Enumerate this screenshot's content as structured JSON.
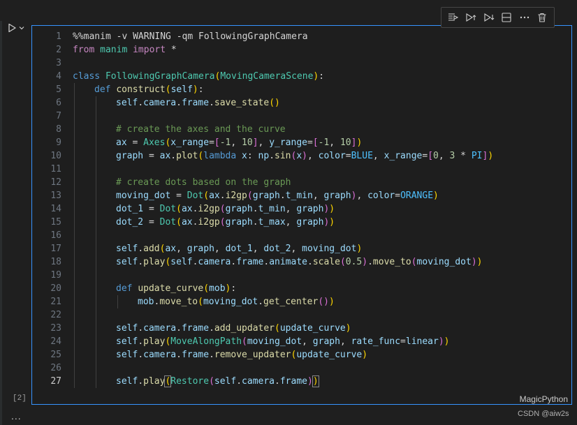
{
  "cell": {
    "execution_count": "[2]",
    "language": "MagicPython",
    "active_line": 27,
    "toolbar": [
      {
        "name": "execute-above-icon",
        "icon": "run-above"
      },
      {
        "name": "execute-below-icon",
        "icon": "run-below"
      },
      {
        "name": "execute-cell-below-icon",
        "icon": "run-cell-below"
      },
      {
        "name": "split-cell-icon",
        "icon": "split"
      },
      {
        "name": "more-actions-icon",
        "icon": "ellipsis"
      },
      {
        "name": "delete-cell-icon",
        "icon": "trash"
      }
    ],
    "lines": [
      {
        "n": "1",
        "indent": 0,
        "tokens": [
          [
            "pl",
            "%%manim -v WARNING -qm FollowingGraphCamera"
          ]
        ]
      },
      {
        "n": "2",
        "indent": 0,
        "tokens": [
          [
            "kw2",
            "from"
          ],
          [
            "pl",
            " "
          ],
          [
            "cls",
            "manim"
          ],
          [
            "pl",
            " "
          ],
          [
            "kw2",
            "import"
          ],
          [
            "pl",
            " *"
          ]
        ]
      },
      {
        "n": "3",
        "indent": 0,
        "tokens": []
      },
      {
        "n": "4",
        "indent": 0,
        "tokens": [
          [
            "kw",
            "class"
          ],
          [
            "pl",
            " "
          ],
          [
            "cls",
            "FollowingGraphCamera"
          ],
          [
            "br1",
            "("
          ],
          [
            "cls",
            "MovingCameraScene"
          ],
          [
            "br1",
            ")"
          ],
          [
            "pl",
            ":"
          ]
        ]
      },
      {
        "n": "5",
        "indent": 1,
        "tokens": [
          [
            "kw",
            "def"
          ],
          [
            "pl",
            " "
          ],
          [
            "fn",
            "construct"
          ],
          [
            "br1",
            "("
          ],
          [
            "self",
            "self"
          ],
          [
            "br1",
            ")"
          ],
          [
            "pl",
            ":"
          ]
        ]
      },
      {
        "n": "6",
        "indent": 2,
        "tokens": [
          [
            "self",
            "self"
          ],
          [
            "pl",
            "."
          ],
          [
            "var",
            "camera"
          ],
          [
            "pl",
            "."
          ],
          [
            "var",
            "frame"
          ],
          [
            "pl",
            "."
          ],
          [
            "fn",
            "save_state"
          ],
          [
            "br1",
            "()"
          ]
        ]
      },
      {
        "n": "7",
        "indent": 2,
        "tokens": []
      },
      {
        "n": "8",
        "indent": 2,
        "tokens": [
          [
            "cm",
            "# create the axes and the curve"
          ]
        ]
      },
      {
        "n": "9",
        "indent": 2,
        "tokens": [
          [
            "var",
            "ax"
          ],
          [
            "pl",
            " = "
          ],
          [
            "cls",
            "Axes"
          ],
          [
            "br1",
            "("
          ],
          [
            "var",
            "x_range"
          ],
          [
            "pl",
            "="
          ],
          [
            "br2",
            "["
          ],
          [
            "num",
            "-1"
          ],
          [
            "pl",
            ", "
          ],
          [
            "num",
            "10"
          ],
          [
            "br2",
            "]"
          ],
          [
            "pl",
            ", "
          ],
          [
            "var",
            "y_range"
          ],
          [
            "pl",
            "="
          ],
          [
            "br2",
            "["
          ],
          [
            "num",
            "-1"
          ],
          [
            "pl",
            ", "
          ],
          [
            "num",
            "10"
          ],
          [
            "br2",
            "]"
          ],
          [
            "br1",
            ")"
          ]
        ]
      },
      {
        "n": "10",
        "indent": 2,
        "tokens": [
          [
            "var",
            "graph"
          ],
          [
            "pl",
            " = "
          ],
          [
            "var",
            "ax"
          ],
          [
            "pl",
            "."
          ],
          [
            "fn",
            "plot"
          ],
          [
            "br1",
            "("
          ],
          [
            "kw",
            "lambda"
          ],
          [
            "pl",
            " "
          ],
          [
            "var",
            "x"
          ],
          [
            "pl",
            ": "
          ],
          [
            "var",
            "np"
          ],
          [
            "pl",
            "."
          ],
          [
            "fn",
            "sin"
          ],
          [
            "br2",
            "("
          ],
          [
            "var",
            "x"
          ],
          [
            "br2",
            ")"
          ],
          [
            "pl",
            ", "
          ],
          [
            "var",
            "color"
          ],
          [
            "pl",
            "="
          ],
          [
            "cst",
            "BLUE"
          ],
          [
            "pl",
            ", "
          ],
          [
            "var",
            "x_range"
          ],
          [
            "pl",
            "="
          ],
          [
            "br2",
            "["
          ],
          [
            "num",
            "0"
          ],
          [
            "pl",
            ", "
          ],
          [
            "num",
            "3"
          ],
          [
            "pl",
            " * "
          ],
          [
            "cst",
            "PI"
          ],
          [
            "br2",
            "]"
          ],
          [
            "br1",
            ")"
          ]
        ]
      },
      {
        "n": "11",
        "indent": 2,
        "tokens": []
      },
      {
        "n": "12",
        "indent": 2,
        "tokens": [
          [
            "cm",
            "# create dots based on the graph"
          ]
        ]
      },
      {
        "n": "13",
        "indent": 2,
        "tokens": [
          [
            "var",
            "moving_dot"
          ],
          [
            "pl",
            " = "
          ],
          [
            "cls",
            "Dot"
          ],
          [
            "br1",
            "("
          ],
          [
            "var",
            "ax"
          ],
          [
            "pl",
            "."
          ],
          [
            "fn",
            "i2gp"
          ],
          [
            "br2",
            "("
          ],
          [
            "var",
            "graph"
          ],
          [
            "pl",
            "."
          ],
          [
            "var",
            "t_min"
          ],
          [
            "pl",
            ", "
          ],
          [
            "var",
            "graph"
          ],
          [
            "br2",
            ")"
          ],
          [
            "pl",
            ", "
          ],
          [
            "var",
            "color"
          ],
          [
            "pl",
            "="
          ],
          [
            "cst",
            "ORANGE"
          ],
          [
            "br1",
            ")"
          ]
        ]
      },
      {
        "n": "14",
        "indent": 2,
        "tokens": [
          [
            "var",
            "dot_1"
          ],
          [
            "pl",
            " = "
          ],
          [
            "cls",
            "Dot"
          ],
          [
            "br1",
            "("
          ],
          [
            "var",
            "ax"
          ],
          [
            "pl",
            "."
          ],
          [
            "fn",
            "i2gp"
          ],
          [
            "br2",
            "("
          ],
          [
            "var",
            "graph"
          ],
          [
            "pl",
            "."
          ],
          [
            "var",
            "t_min"
          ],
          [
            "pl",
            ", "
          ],
          [
            "var",
            "graph"
          ],
          [
            "br2",
            ")"
          ],
          [
            "br1",
            ")"
          ]
        ]
      },
      {
        "n": "15",
        "indent": 2,
        "tokens": [
          [
            "var",
            "dot_2"
          ],
          [
            "pl",
            " = "
          ],
          [
            "cls",
            "Dot"
          ],
          [
            "br1",
            "("
          ],
          [
            "var",
            "ax"
          ],
          [
            "pl",
            "."
          ],
          [
            "fn",
            "i2gp"
          ],
          [
            "br2",
            "("
          ],
          [
            "var",
            "graph"
          ],
          [
            "pl",
            "."
          ],
          [
            "var",
            "t_max"
          ],
          [
            "pl",
            ", "
          ],
          [
            "var",
            "graph"
          ],
          [
            "br2",
            ")"
          ],
          [
            "br1",
            ")"
          ]
        ]
      },
      {
        "n": "16",
        "indent": 2,
        "tokens": []
      },
      {
        "n": "17",
        "indent": 2,
        "tokens": [
          [
            "self",
            "self"
          ],
          [
            "pl",
            "."
          ],
          [
            "fn",
            "add"
          ],
          [
            "br1",
            "("
          ],
          [
            "var",
            "ax"
          ],
          [
            "pl",
            ", "
          ],
          [
            "var",
            "graph"
          ],
          [
            "pl",
            ", "
          ],
          [
            "var",
            "dot_1"
          ],
          [
            "pl",
            ", "
          ],
          [
            "var",
            "dot_2"
          ],
          [
            "pl",
            ", "
          ],
          [
            "var",
            "moving_dot"
          ],
          [
            "br1",
            ")"
          ]
        ]
      },
      {
        "n": "18",
        "indent": 2,
        "tokens": [
          [
            "self",
            "self"
          ],
          [
            "pl",
            "."
          ],
          [
            "fn",
            "play"
          ],
          [
            "br1",
            "("
          ],
          [
            "self",
            "self"
          ],
          [
            "pl",
            "."
          ],
          [
            "var",
            "camera"
          ],
          [
            "pl",
            "."
          ],
          [
            "var",
            "frame"
          ],
          [
            "pl",
            "."
          ],
          [
            "var",
            "animate"
          ],
          [
            "pl",
            "."
          ],
          [
            "fn",
            "scale"
          ],
          [
            "br2",
            "("
          ],
          [
            "num",
            "0.5"
          ],
          [
            "br2",
            ")"
          ],
          [
            "pl",
            "."
          ],
          [
            "fn",
            "move_to"
          ],
          [
            "br2",
            "("
          ],
          [
            "var",
            "moving_dot"
          ],
          [
            "br2",
            ")"
          ],
          [
            "br1",
            ")"
          ]
        ]
      },
      {
        "n": "19",
        "indent": 2,
        "tokens": []
      },
      {
        "n": "20",
        "indent": 2,
        "tokens": [
          [
            "kw",
            "def"
          ],
          [
            "pl",
            " "
          ],
          [
            "fn",
            "update_curve"
          ],
          [
            "br1",
            "("
          ],
          [
            "var",
            "mob"
          ],
          [
            "br1",
            ")"
          ],
          [
            "pl",
            ":"
          ]
        ]
      },
      {
        "n": "21",
        "indent": 3,
        "tokens": [
          [
            "var",
            "mob"
          ],
          [
            "pl",
            "."
          ],
          [
            "fn",
            "move_to"
          ],
          [
            "br1",
            "("
          ],
          [
            "var",
            "moving_dot"
          ],
          [
            "pl",
            "."
          ],
          [
            "fn",
            "get_center"
          ],
          [
            "br2",
            "()"
          ],
          [
            "br1",
            ")"
          ]
        ]
      },
      {
        "n": "22",
        "indent": 2,
        "tokens": []
      },
      {
        "n": "23",
        "indent": 2,
        "tokens": [
          [
            "self",
            "self"
          ],
          [
            "pl",
            "."
          ],
          [
            "var",
            "camera"
          ],
          [
            "pl",
            "."
          ],
          [
            "var",
            "frame"
          ],
          [
            "pl",
            "."
          ],
          [
            "fn",
            "add_updater"
          ],
          [
            "br1",
            "("
          ],
          [
            "var",
            "update_curve"
          ],
          [
            "br1",
            ")"
          ]
        ]
      },
      {
        "n": "24",
        "indent": 2,
        "tokens": [
          [
            "self",
            "self"
          ],
          [
            "pl",
            "."
          ],
          [
            "fn",
            "play"
          ],
          [
            "br1",
            "("
          ],
          [
            "cls",
            "MoveAlongPath"
          ],
          [
            "br2",
            "("
          ],
          [
            "var",
            "moving_dot"
          ],
          [
            "pl",
            ", "
          ],
          [
            "var",
            "graph"
          ],
          [
            "pl",
            ", "
          ],
          [
            "var",
            "rate_func"
          ],
          [
            "pl",
            "="
          ],
          [
            "var",
            "linear"
          ],
          [
            "br2",
            ")"
          ],
          [
            "br1",
            ")"
          ]
        ]
      },
      {
        "n": "25",
        "indent": 2,
        "tokens": [
          [
            "self",
            "self"
          ],
          [
            "pl",
            "."
          ],
          [
            "var",
            "camera"
          ],
          [
            "pl",
            "."
          ],
          [
            "var",
            "frame"
          ],
          [
            "pl",
            "."
          ],
          [
            "fn",
            "remove_updater"
          ],
          [
            "br1",
            "("
          ],
          [
            "var",
            "update_curve"
          ],
          [
            "br1",
            ")"
          ]
        ]
      },
      {
        "n": "26",
        "indent": 2,
        "tokens": []
      },
      {
        "n": "27",
        "indent": 2,
        "tokens": [
          [
            "self",
            "self"
          ],
          [
            "pl",
            "."
          ],
          [
            "fn",
            "play"
          ],
          [
            "br1 hl",
            "("
          ],
          [
            "cls",
            "Restore"
          ],
          [
            "br2",
            "("
          ],
          [
            "self",
            "self"
          ],
          [
            "pl",
            "."
          ],
          [
            "var",
            "camera"
          ],
          [
            "pl",
            "."
          ],
          [
            "var",
            "frame"
          ],
          [
            "br2",
            ")"
          ],
          [
            "br1 hl",
            ")"
          ]
        ]
      }
    ]
  },
  "footer": {
    "more": "...",
    "watermark": "CSDN @aiw2s"
  }
}
